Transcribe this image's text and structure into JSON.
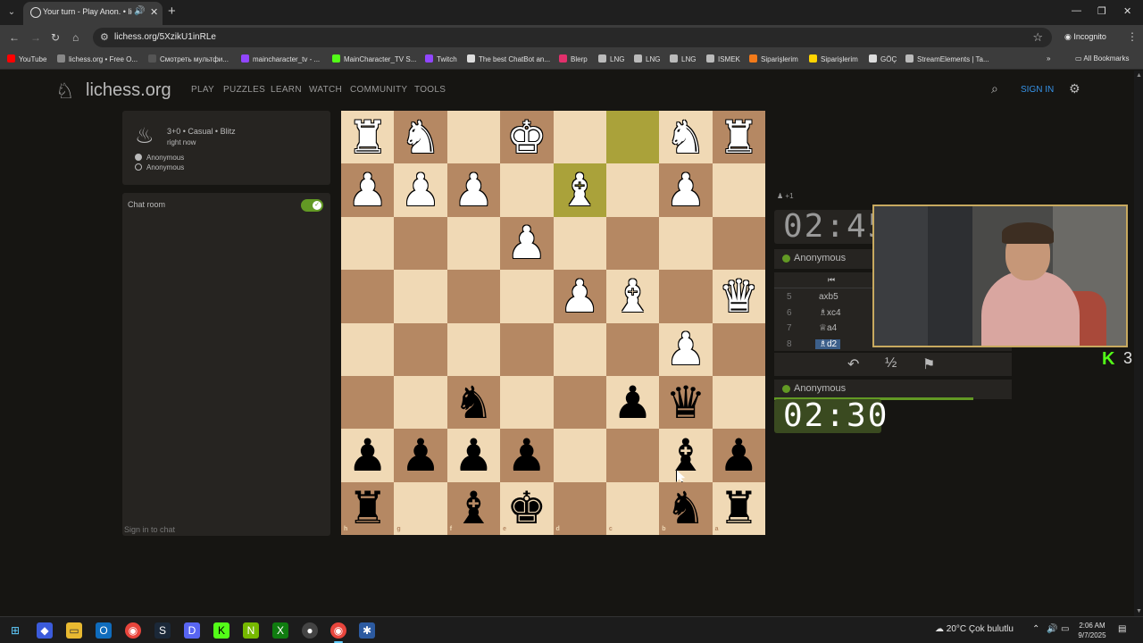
{
  "browser": {
    "tab_title": "Your turn - Play Anon. • lich",
    "url": "lichess.org/5XzikU1inRLe",
    "incognito_label": "Incognito",
    "bookmarks": [
      {
        "label": "YouTube",
        "color": "#ff0000"
      },
      {
        "label": "lichess.org • Free O...",
        "color": "#888888"
      },
      {
        "label": "Смотреть мультфи...",
        "color": "#555555"
      },
      {
        "label": "maincharacter_tv - ...",
        "color": "#9146ff"
      },
      {
        "label": "MainCharacter_TV S...",
        "color": "#53fc18"
      },
      {
        "label": "Twitch",
        "color": "#9146ff"
      },
      {
        "label": "The best ChatBot an...",
        "color": "#dddddd"
      },
      {
        "label": "Blerp",
        "color": "#e2306c"
      },
      {
        "label": "LNG",
        "color": "#bbbbbb"
      },
      {
        "label": "LNG",
        "color": "#bbbbbb"
      },
      {
        "label": "LNG",
        "color": "#bbbbbb"
      },
      {
        "label": "ISMEK",
        "color": "#bbbbbb"
      },
      {
        "label": "Siparişlerim",
        "color": "#f27a1a"
      },
      {
        "label": "Siparişlerim",
        "color": "#ffd400"
      },
      {
        "label": "GÖÇ",
        "color": "#dddddd"
      },
      {
        "label": "StreamElements | Ta...",
        "color": "#bbbbbb"
      }
    ],
    "all_bookmarks": "All Bookmarks"
  },
  "site": {
    "logo": "lichess.org",
    "nav": [
      "PLAY",
      "PUZZLES",
      "LEARN",
      "WATCH",
      "COMMUNITY",
      "TOOLS"
    ],
    "signin": "SIGN IN"
  },
  "game": {
    "setup": "3+0 • Casual • Blitz",
    "when": "right now",
    "white": "Anonymous",
    "black": "Anonymous",
    "chat_label": "Chat room",
    "chat_signin": "Sign in to chat",
    "spectators": "+1",
    "top_clock": "02:45",
    "bottom_clock": "02:30",
    "top_player": "Anonymous",
    "bottom_player": "Anonymous",
    "moves": [
      {
        "num": "5",
        "move": "axb5"
      },
      {
        "num": "6",
        "move": "♗xc4"
      },
      {
        "num": "7",
        "move": "♕a4"
      },
      {
        "num": "8",
        "move": "♗d2",
        "active": true
      }
    ],
    "draw_label": "½",
    "stream_count": "3",
    "ranks": [
      "1",
      "2",
      "3",
      "4",
      "5",
      "6",
      "7",
      "8"
    ],
    "files": [
      "h",
      "g",
      "f",
      "e",
      "d",
      "c",
      "b",
      "a"
    ],
    "board": [
      [
        "wR",
        "wN",
        "",
        "wK",
        "",
        "",
        "wN",
        "wR"
      ],
      [
        "wP",
        "wP",
        "wP",
        "",
        "wB",
        "",
        "wP",
        ""
      ],
      [
        "",
        "",
        "",
        "wP",
        "",
        "",
        "",
        ""
      ],
      [
        "",
        "",
        "",
        "",
        "wP",
        "wB",
        "",
        "wQ"
      ],
      [
        "",
        "",
        "",
        "",
        "",
        "",
        "wP",
        ""
      ],
      [
        "",
        "",
        "bN",
        "",
        "",
        "bP",
        "bQ",
        ""
      ],
      [
        "bP",
        "bP",
        "bP",
        "bP",
        "",
        "",
        "bB",
        "bP"
      ],
      [
        "bR",
        "",
        "bB",
        "bK",
        "",
        "",
        "bN",
        "bR"
      ]
    ],
    "highlight": [
      [
        0,
        5
      ],
      [
        1,
        4
      ]
    ]
  },
  "taskbar": {
    "weather": "20°C  Çok bulutlu",
    "time": "2:06 AM",
    "date": "9/7/2025"
  }
}
